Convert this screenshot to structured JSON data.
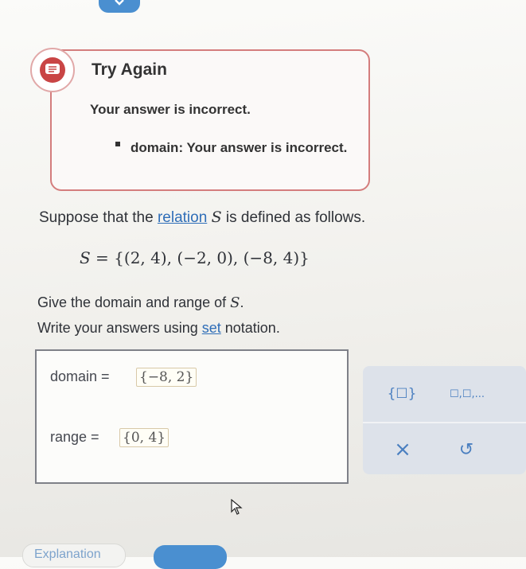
{
  "feedback": {
    "title": "Try Again",
    "message": "Your answer is incorrect.",
    "bullet": "domain: Your answer is incorrect."
  },
  "question": {
    "intro_pre": "Suppose that the ",
    "intro_link": "relation",
    "intro_var": "S",
    "intro_post": " is defined as follows.",
    "set_definition_var": "S",
    "set_definition": " = {(2, 4), (−2, 0), (−8, 4)}",
    "prompt_pre": "Give the domain and range of ",
    "prompt_var": "S",
    "prompt_post": ".",
    "instruction_pre": "Write your answers using ",
    "instruction_link": "set",
    "instruction_post": " notation."
  },
  "answers": {
    "domain_label": "domain  =",
    "domain_value": "{−8, 2}",
    "range_label": "range  =",
    "range_value": "{0, 4}"
  },
  "tools": {
    "set_braces": "{☐}",
    "list": "☐,☐,...",
    "clear": "×",
    "undo": "↺"
  },
  "footer": {
    "explanation_label": "Explanation"
  },
  "colors": {
    "feedback_border": "#d47d7d",
    "feedback_icon": "#c94545",
    "link": "#2f6eb8",
    "accent": "#4a8fd0",
    "tool_panel": "#dde2ea"
  }
}
